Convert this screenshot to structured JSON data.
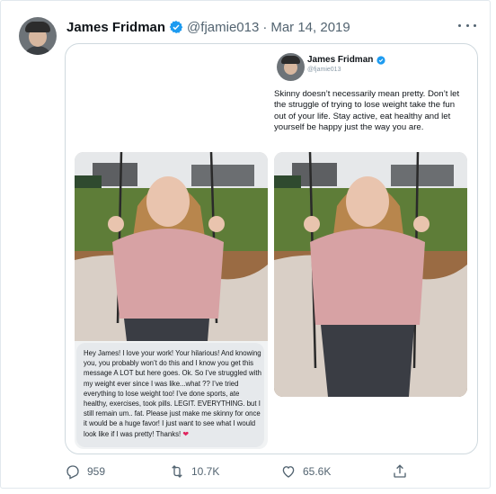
{
  "tweet": {
    "author_name": "James Fridman",
    "handle": "@fjamie013",
    "separator": "·",
    "date": "Mar 14, 2019",
    "more_icon": "more-dots-icon",
    "verified_icon": "verified-badge-icon",
    "accent_color": "#1d9bf0"
  },
  "quoted": {
    "author_name": "James Fridman",
    "handle": "@fjamie013",
    "text": "Skinny doesn’t necessarily mean pretty. Don’t let the struggle of trying to lose weight take the fun out of your life. Stay active, eat healthy and let yourself be happy just the way you are."
  },
  "message": {
    "text": "Hey James! I love your work! Your hilarious! And knowing you, you probably won’t do this and I know you get this message A LOT but here goes. Ok. So I’ve struggled with my weight ever since I was like...what ?? I’ve tried everything to lose weight too! I’ve done sports, ate healthy, exercises, took pills. LEGIT. EVERYTHING. but I still remain um.. fat. Please just make me skinny for once it would be a huge favor! I just want to see what I would look like if I was pretty! Thanks!",
    "emoji": "❤"
  },
  "actions": {
    "reply_count": "959",
    "retweet_count": "10.7K",
    "like_count": "65.6K",
    "reply_icon": "reply-icon",
    "retweet_icon": "retweet-icon",
    "like_icon": "heart-icon",
    "share_icon": "share-icon"
  }
}
